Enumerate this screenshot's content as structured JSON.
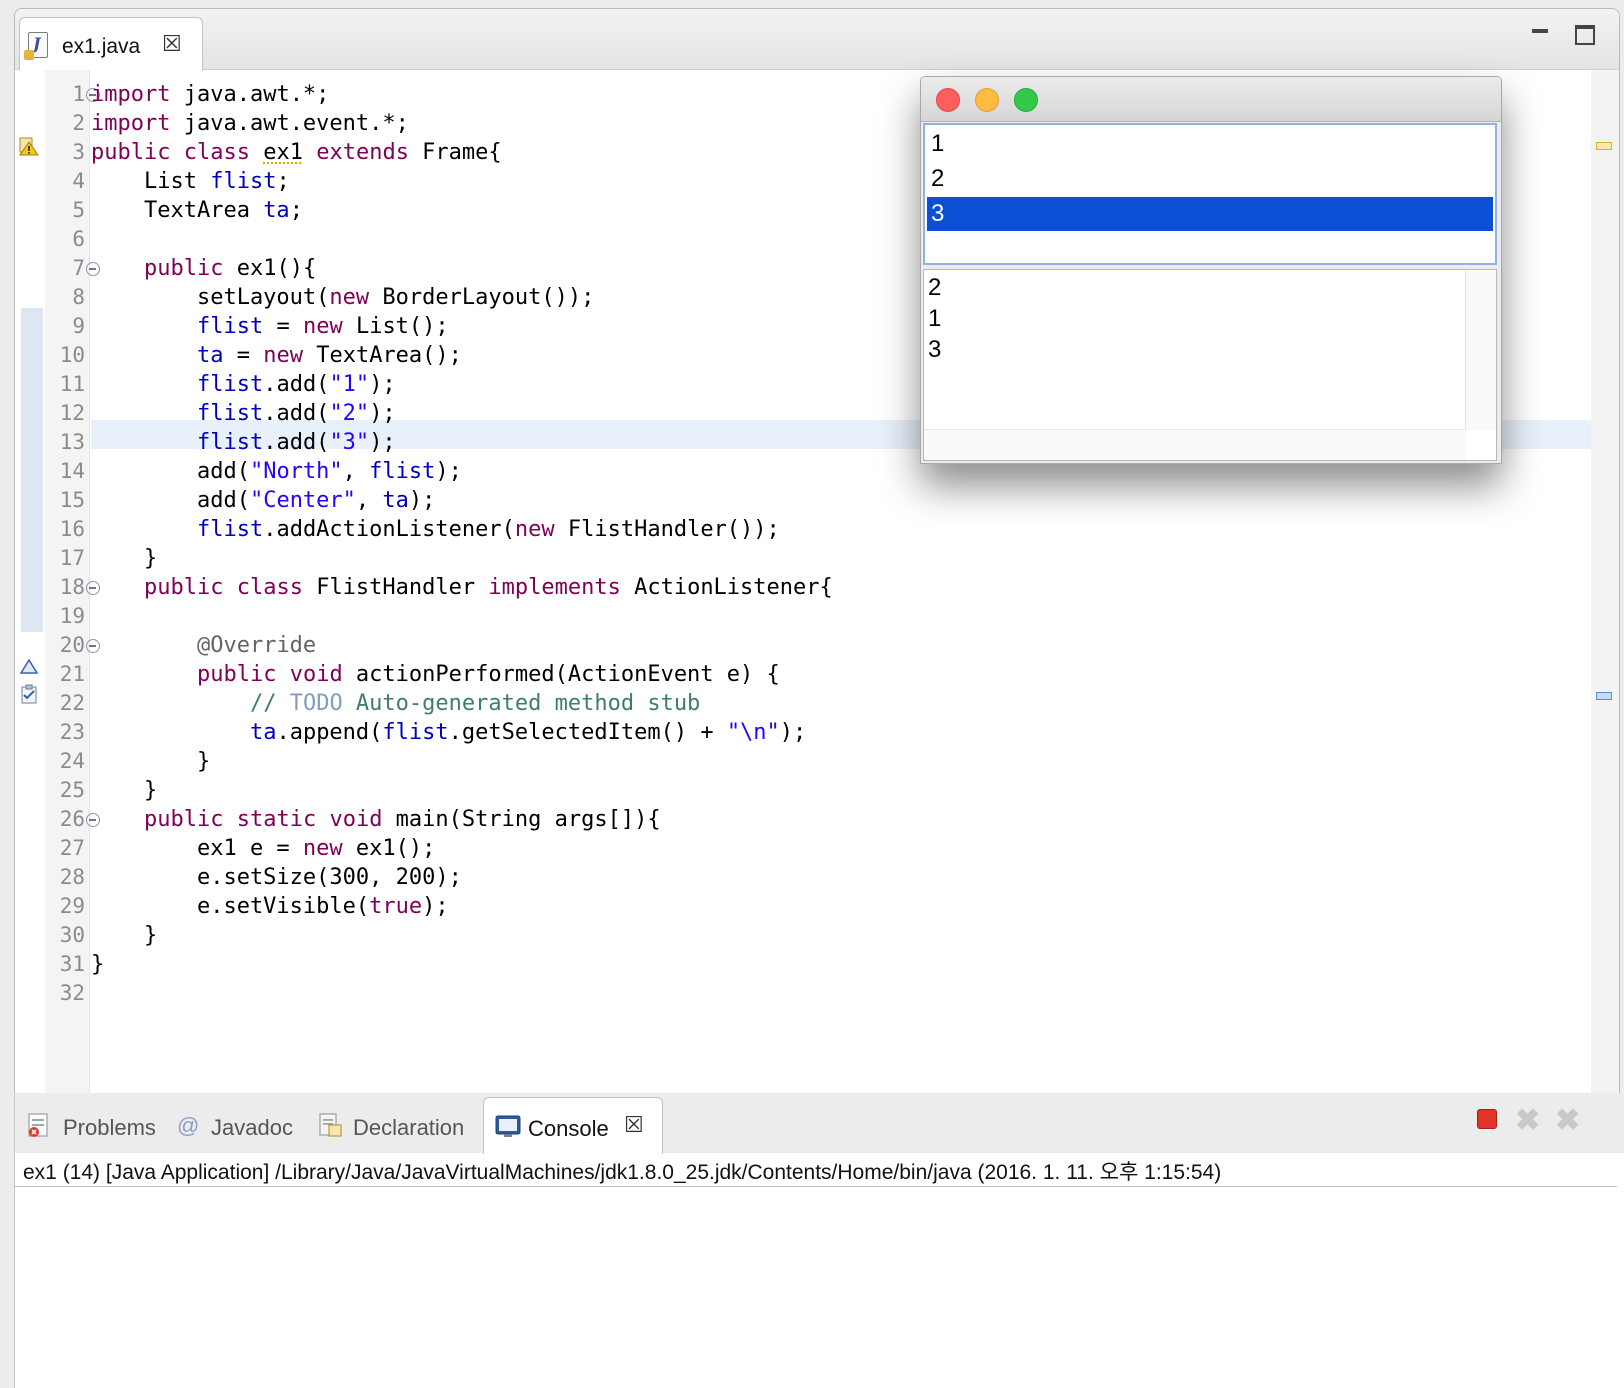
{
  "editor": {
    "tab": {
      "label": "ex1.java",
      "close_icon": "close-icon"
    },
    "current_line": 13,
    "lines": [
      {
        "n": "1",
        "tokens": [
          {
            "c": "kw",
            "t": "import"
          },
          {
            "c": "",
            "t": " java.awt.*;"
          }
        ]
      },
      {
        "n": "2",
        "tokens": [
          {
            "c": "kw",
            "t": "import"
          },
          {
            "c": "",
            "t": " java.awt.event.*;"
          }
        ]
      },
      {
        "n": "3",
        "tokens": [
          {
            "c": "kw",
            "t": "public"
          },
          {
            "c": "",
            "t": " "
          },
          {
            "c": "kw",
            "t": "class"
          },
          {
            "c": "",
            "t": " "
          },
          {
            "c": "warn",
            "t": "ex1"
          },
          {
            "c": "",
            "t": " "
          },
          {
            "c": "kw",
            "t": "extends"
          },
          {
            "c": "",
            "t": " Frame{"
          }
        ]
      },
      {
        "n": "4",
        "tokens": [
          {
            "c": "",
            "t": "    List "
          },
          {
            "c": "fld",
            "t": "flist"
          },
          {
            "c": "",
            "t": ";"
          }
        ]
      },
      {
        "n": "5",
        "tokens": [
          {
            "c": "",
            "t": "    TextArea "
          },
          {
            "c": "fld",
            "t": "ta"
          },
          {
            "c": "",
            "t": ";"
          }
        ]
      },
      {
        "n": "6",
        "tokens": []
      },
      {
        "n": "7",
        "tokens": [
          {
            "c": "",
            "t": "    "
          },
          {
            "c": "kw",
            "t": "public"
          },
          {
            "c": "",
            "t": " ex1(){"
          }
        ]
      },
      {
        "n": "8",
        "tokens": [
          {
            "c": "",
            "t": "        setLayout("
          },
          {
            "c": "kw",
            "t": "new"
          },
          {
            "c": "",
            "t": " BorderLayout());"
          }
        ]
      },
      {
        "n": "9",
        "tokens": [
          {
            "c": "",
            "t": "        "
          },
          {
            "c": "fld",
            "t": "flist"
          },
          {
            "c": "",
            "t": " = "
          },
          {
            "c": "kw",
            "t": "new"
          },
          {
            "c": "",
            "t": " List();"
          }
        ]
      },
      {
        "n": "10",
        "tokens": [
          {
            "c": "",
            "t": "        "
          },
          {
            "c": "fld",
            "t": "ta"
          },
          {
            "c": "",
            "t": " = "
          },
          {
            "c": "kw",
            "t": "new"
          },
          {
            "c": "",
            "t": " TextArea();"
          }
        ]
      },
      {
        "n": "11",
        "tokens": [
          {
            "c": "",
            "t": "        "
          },
          {
            "c": "fld",
            "t": "flist"
          },
          {
            "c": "",
            "t": ".add("
          },
          {
            "c": "str",
            "t": "\"1\""
          },
          {
            "c": "",
            "t": ");"
          }
        ]
      },
      {
        "n": "12",
        "tokens": [
          {
            "c": "",
            "t": "        "
          },
          {
            "c": "fld",
            "t": "flist"
          },
          {
            "c": "",
            "t": ".add("
          },
          {
            "c": "str",
            "t": "\"2\""
          },
          {
            "c": "",
            "t": ");"
          }
        ]
      },
      {
        "n": "13",
        "tokens": [
          {
            "c": "",
            "t": "        "
          },
          {
            "c": "fld",
            "t": "flist"
          },
          {
            "c": "",
            "t": ".add("
          },
          {
            "c": "str",
            "t": "\"3\""
          },
          {
            "c": "",
            "t": ");"
          }
        ]
      },
      {
        "n": "14",
        "tokens": [
          {
            "c": "",
            "t": "        add("
          },
          {
            "c": "str",
            "t": "\"North\""
          },
          {
            "c": "",
            "t": ", "
          },
          {
            "c": "fld",
            "t": "flist"
          },
          {
            "c": "",
            "t": ");"
          }
        ]
      },
      {
        "n": "15",
        "tokens": [
          {
            "c": "",
            "t": "        add("
          },
          {
            "c": "str",
            "t": "\"Center\""
          },
          {
            "c": "",
            "t": ", "
          },
          {
            "c": "fld",
            "t": "ta"
          },
          {
            "c": "",
            "t": ");"
          }
        ]
      },
      {
        "n": "16",
        "tokens": [
          {
            "c": "",
            "t": "        "
          },
          {
            "c": "fld",
            "t": "flist"
          },
          {
            "c": "",
            "t": ".addActionListener("
          },
          {
            "c": "kw",
            "t": "new"
          },
          {
            "c": "",
            "t": " FlistHandler());"
          }
        ]
      },
      {
        "n": "17",
        "tokens": [
          {
            "c": "",
            "t": "    }"
          }
        ]
      },
      {
        "n": "18",
        "tokens": [
          {
            "c": "",
            "t": "    "
          },
          {
            "c": "kw",
            "t": "public"
          },
          {
            "c": "",
            "t": " "
          },
          {
            "c": "kw",
            "t": "class"
          },
          {
            "c": "",
            "t": " FlistHandler "
          },
          {
            "c": "kw",
            "t": "implements"
          },
          {
            "c": "",
            "t": " ActionListener{"
          }
        ]
      },
      {
        "n": "19",
        "tokens": []
      },
      {
        "n": "20",
        "tokens": [
          {
            "c": "",
            "t": "        "
          },
          {
            "c": "ann",
            "t": "@Override"
          }
        ]
      },
      {
        "n": "21",
        "tokens": [
          {
            "c": "",
            "t": "        "
          },
          {
            "c": "kw",
            "t": "public"
          },
          {
            "c": "",
            "t": " "
          },
          {
            "c": "kw",
            "t": "void"
          },
          {
            "c": "",
            "t": " actionPerformed(ActionEvent "
          },
          {
            "c": "",
            "t": "e"
          },
          {
            "c": "",
            "t": ") {"
          }
        ]
      },
      {
        "n": "22",
        "tokens": [
          {
            "c": "",
            "t": "            "
          },
          {
            "c": "cmt",
            "t": "// "
          },
          {
            "c": "todo",
            "t": "TODO"
          },
          {
            "c": "cmt",
            "t": " Auto-generated method stub"
          }
        ]
      },
      {
        "n": "23",
        "tokens": [
          {
            "c": "",
            "t": "            "
          },
          {
            "c": "fld",
            "t": "ta"
          },
          {
            "c": "",
            "t": ".append("
          },
          {
            "c": "fld",
            "t": "flist"
          },
          {
            "c": "",
            "t": ".getSelectedItem() + "
          },
          {
            "c": "str",
            "t": "\"\\n\""
          },
          {
            "c": "",
            "t": ");"
          }
        ]
      },
      {
        "n": "24",
        "tokens": [
          {
            "c": "",
            "t": "        }"
          }
        ]
      },
      {
        "n": "25",
        "tokens": [
          {
            "c": "",
            "t": "    }"
          }
        ]
      },
      {
        "n": "26",
        "tokens": [
          {
            "c": "",
            "t": "    "
          },
          {
            "c": "kw",
            "t": "public"
          },
          {
            "c": "",
            "t": " "
          },
          {
            "c": "kw",
            "t": "static"
          },
          {
            "c": "",
            "t": " "
          },
          {
            "c": "kw",
            "t": "void"
          },
          {
            "c": "",
            "t": " main(String "
          },
          {
            "c": "",
            "t": "args"
          },
          {
            "c": "",
            "t": "[]){"
          }
        ]
      },
      {
        "n": "27",
        "tokens": [
          {
            "c": "",
            "t": "        ex1 e = "
          },
          {
            "c": "kw",
            "t": "new"
          },
          {
            "c": "",
            "t": " ex1();"
          }
        ]
      },
      {
        "n": "28",
        "tokens": [
          {
            "c": "",
            "t": "        e.setSize(300, 200);"
          }
        ]
      },
      {
        "n": "29",
        "tokens": [
          {
            "c": "",
            "t": "        e.setVisible("
          },
          {
            "c": "kw",
            "t": "true"
          },
          {
            "c": "",
            "t": ");"
          }
        ]
      },
      {
        "n": "30",
        "tokens": [
          {
            "c": "",
            "t": "    }"
          }
        ]
      },
      {
        "n": "31",
        "tokens": [
          {
            "c": "",
            "t": "}"
          }
        ]
      },
      {
        "n": "32",
        "tokens": []
      }
    ],
    "folds": [
      "1",
      "7",
      "18",
      "20",
      "26"
    ]
  },
  "awt_window": {
    "list_items": [
      "1",
      "2",
      "3"
    ],
    "selected_item": "3",
    "textarea_lines": [
      "2",
      "1",
      "3"
    ]
  },
  "bottom_panel": {
    "tabs": [
      {
        "label": "Problems",
        "icon": "problems-icon",
        "active": false
      },
      {
        "label": "Javadoc",
        "icon": "at-sign-icon",
        "active": false
      },
      {
        "label": "Declaration",
        "icon": "declaration-icon",
        "active": false
      },
      {
        "label": "Console",
        "icon": "console-icon",
        "active": true
      }
    ],
    "console_description": "ex1 (14) [Java Application] /Library/Java/JavaVirtualMachines/jdk1.8.0_25.jdk/Contents/Home/bin/java (2016. 1. 11. 오후 1:15:54)"
  },
  "colors": {
    "keyword": "#7f0055",
    "field": "#0000c0",
    "string": "#2a00ff",
    "comment": "#3f7f5f",
    "selection": "#0b4fd4"
  }
}
